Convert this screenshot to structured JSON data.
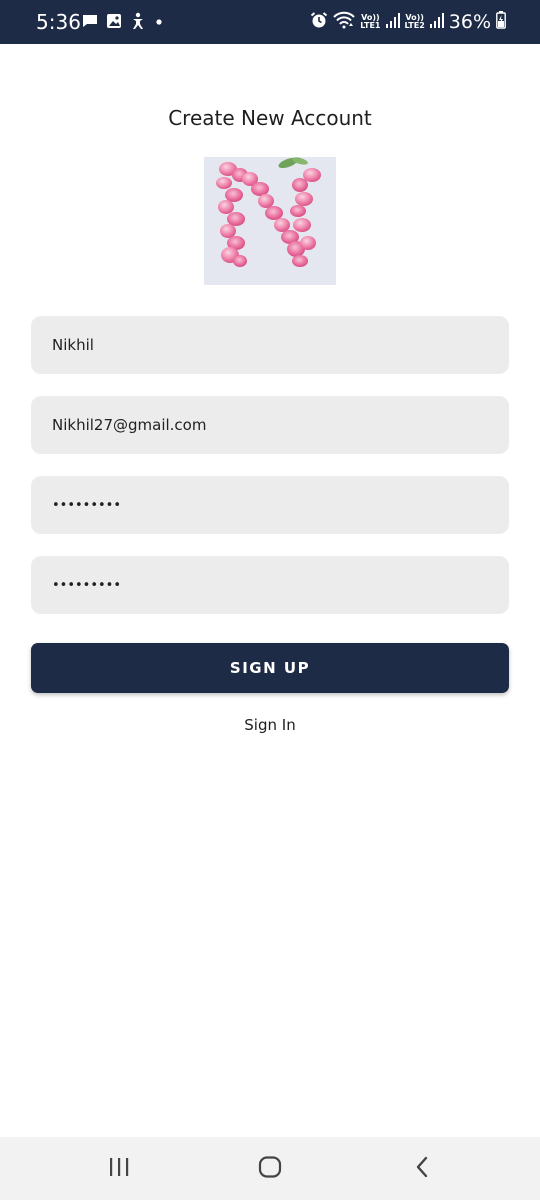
{
  "status_bar": {
    "time": "5:36",
    "battery": "36%",
    "sim1_label_top": "Vo))",
    "sim1_label_bottom": "LTE1",
    "sim2_label_top": "Vo))",
    "sim2_label_bottom": "LTE2",
    "icons": [
      "chat-icon",
      "image-icon",
      "accessibility-icon",
      "dot-icon",
      "alarm-icon",
      "wifi-icon",
      "signal-icon",
      "signal-icon",
      "battery-icon"
    ]
  },
  "page": {
    "title": "Create New Account"
  },
  "form": {
    "name_value": "Nikhil",
    "email_value": "Nikhil27@gmail.com",
    "password_value": "•••••••••",
    "confirm_password_value": "•••••••••"
  },
  "actions": {
    "signup_label": "SIGN UP",
    "signin_label": "Sign In"
  },
  "colors": {
    "primary": "#1e2b47",
    "field_bg": "#ececec",
    "logo_pink": "#e9759f"
  },
  "nav": {
    "icons": [
      "recent-apps-icon",
      "home-icon",
      "back-icon"
    ]
  }
}
